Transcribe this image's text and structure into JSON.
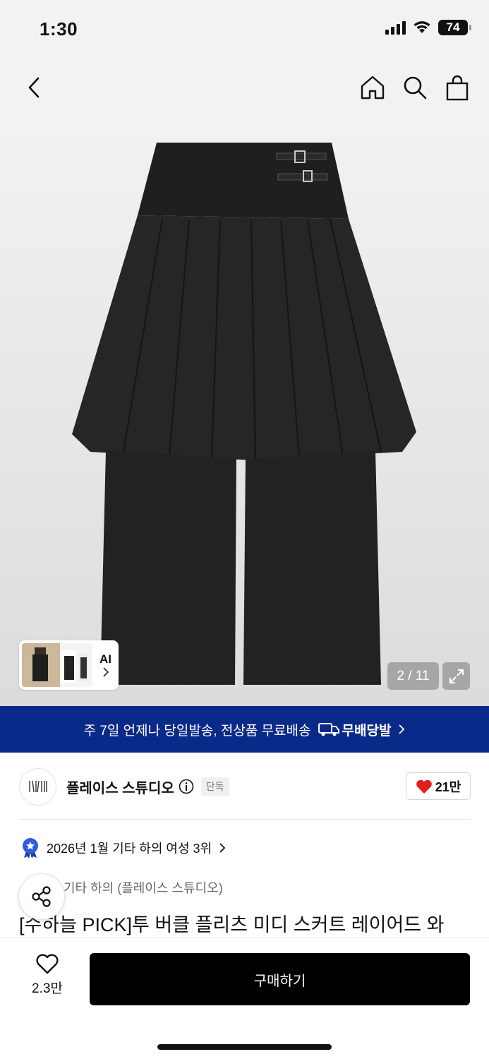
{
  "status_bar": {
    "time": "1:30",
    "battery": "74"
  },
  "product": {
    "page_indicator": "2 / 11",
    "ai_label": "AI",
    "title": "[수하늘 PICK]투 버클 플리츠 미디 스커트 레이어드 와"
  },
  "shipping_banner": {
    "text": "주 7일 언제나 당일발송, 전상품 무료배송",
    "brand": "무배당발"
  },
  "brand": {
    "name": "플레이스 스튜디오",
    "badge": "단독",
    "likes": "21만"
  },
  "ranking": {
    "text": "2026년 1월 기타 하의 여성 3위"
  },
  "category": {
    "text": "기타 하의 (플레이스 스튜디오)"
  },
  "bottom_bar": {
    "wish_count": "2.3만",
    "buy_label": "구매하기"
  },
  "colors": {
    "banner": "#0a2a8a",
    "heart": "#e0201f",
    "buy": "#000000"
  }
}
